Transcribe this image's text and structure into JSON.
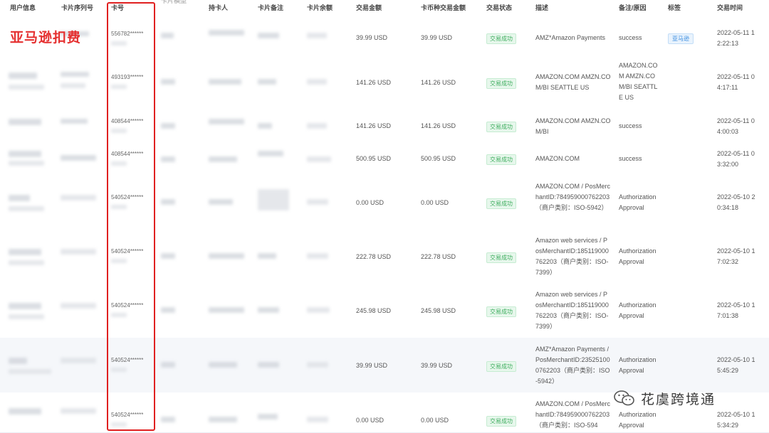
{
  "headers": {
    "user_info": "用户信息",
    "card_serial": "卡片序列号",
    "card_no": "卡号",
    "card_model": "卡片模型",
    "holder": "持卡人",
    "card_note": "卡片备注",
    "card_balance": "卡片余额",
    "tx_amount": "交易金额",
    "card_currency_amount": "卡币种交易金额",
    "tx_status": "交易状态",
    "description": "描述",
    "remark": "备注/原因",
    "tag": "标签",
    "tx_time": "交易时间"
  },
  "overlay": {
    "title": "亚马逊扣费",
    "watermark": "花虞跨境通"
  },
  "rows": [
    {
      "card_no": "556782******",
      "amount": "39.99 USD",
      "card_amount": "39.99 USD",
      "status": "交易成功",
      "description": "AMZ*Amazon Payments",
      "remark": "success",
      "tag": "亚马逊",
      "time": "2022-05-11 12:22:13"
    },
    {
      "card_no": "493193******",
      "amount": "141.26 USD",
      "card_amount": "141.26 USD",
      "status": "交易成功",
      "description": "AMAZON.COM AMZN.COM/BI SEATTLE US",
      "remark": "AMAZON.COM AMZN.COM/BI SEATTLE US",
      "tag": "",
      "time": "2022-05-11 04:17:11"
    },
    {
      "card_no": "408544******",
      "amount": "141.26 USD",
      "card_amount": "141.26 USD",
      "status": "交易成功",
      "description": "AMAZON.COM AMZN.COM/BI",
      "remark": "success",
      "tag": "",
      "time": "2022-05-11 04:00:03"
    },
    {
      "card_no": "408544******",
      "amount": "500.95 USD",
      "card_amount": "500.95 USD",
      "status": "交易成功",
      "description": "AMAZON.COM",
      "remark": "success",
      "tag": "",
      "time": "2022-05-11 03:32:00"
    },
    {
      "card_no": "540524******",
      "amount": "0.00 USD",
      "card_amount": "0.00 USD",
      "status": "交易成功",
      "description": "AMAZON.COM / PosMerchantID:784959000762203（商户类别：ISO-5942）",
      "remark": "Authorization Approval",
      "tag": "",
      "time": "2022-05-10 20:34:18"
    },
    {
      "card_no": "540524******",
      "amount": "222.78 USD",
      "card_amount": "222.78 USD",
      "status": "交易成功",
      "description": "Amazon web services / PosMerchantID:185119000762203（商户类别：ISO-7399）",
      "remark": "Authorization Approval",
      "tag": "",
      "time": "2022-05-10 17:02:32"
    },
    {
      "card_no": "540524******",
      "amount": "245.98 USD",
      "card_amount": "245.98 USD",
      "status": "交易成功",
      "description": "Amazon web services / PosMerchantID:185119000762203（商户类别：ISO-7399）",
      "remark": "Authorization Approval",
      "tag": "",
      "time": "2022-05-10 17:01:38"
    },
    {
      "card_no": "540524******",
      "amount": "39.99 USD",
      "card_amount": "39.99 USD",
      "status": "交易成功",
      "description": "AMZ*Amazon Payments / PosMerchantID:235251000762203（商户类别：ISO-5942）",
      "remark": "Authorization Approval",
      "tag": "",
      "time": "2022-05-10 15:45:29"
    },
    {
      "card_no": "540524******",
      "amount": "0.00 USD",
      "card_amount": "0.00 USD",
      "status": "交易成功",
      "description": "AMAZON.COM / PosMerchantID:784959000762203（商户类别：ISO-594",
      "remark": "Authorization Approval",
      "tag": "",
      "time": "2022-05-10 15:34:29"
    }
  ]
}
